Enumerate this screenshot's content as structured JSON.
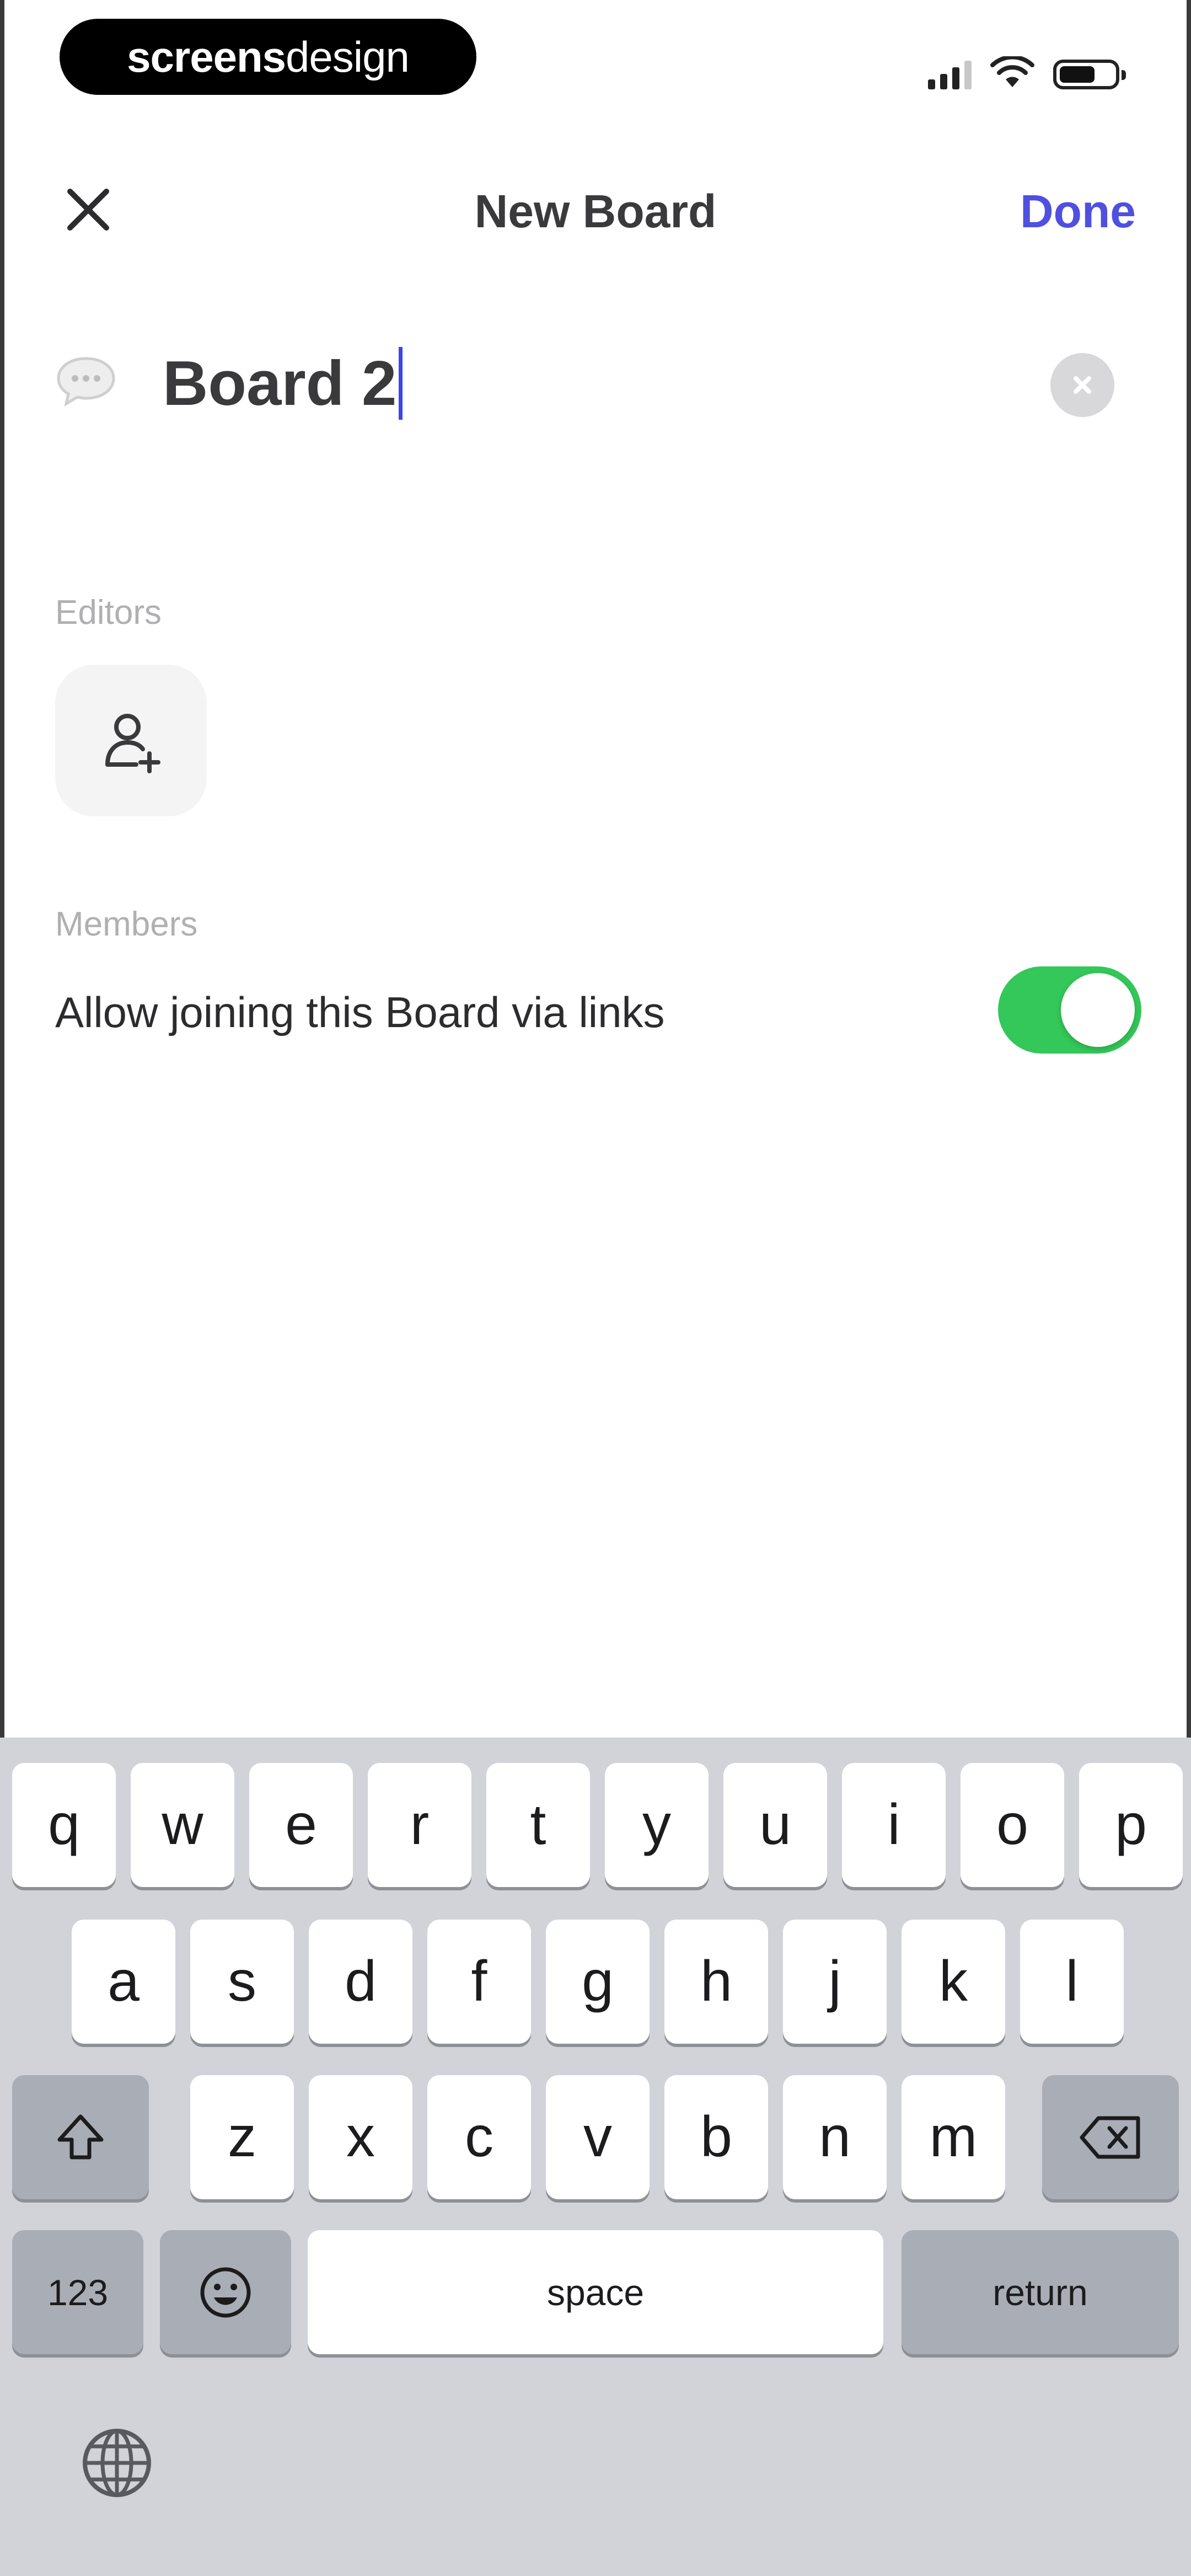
{
  "status_bar": {
    "brand_bold": "screens",
    "brand_light": "design"
  },
  "nav": {
    "title": "New Board",
    "done_label": "Done",
    "close_icon": "close-icon"
  },
  "board": {
    "name_value": "Board 2",
    "icon": "chat-bubble-icon",
    "clear_icon": "clear-circle-icon"
  },
  "editors": {
    "label": "Editors",
    "add_icon": "add-person-icon"
  },
  "members": {
    "label": "Members",
    "link_join_label": "Allow joining this Board via links",
    "link_join_enabled": true
  },
  "keyboard": {
    "row1": [
      "q",
      "w",
      "e",
      "r",
      "t",
      "y",
      "u",
      "i",
      "o",
      "p"
    ],
    "row2": [
      "a",
      "s",
      "d",
      "f",
      "g",
      "h",
      "j",
      "k",
      "l"
    ],
    "row3": [
      "z",
      "x",
      "c",
      "v",
      "b",
      "n",
      "m"
    ],
    "numbers_label": "123",
    "space_label": "space",
    "return_label": "return",
    "shift_icon": "shift-icon",
    "backspace_icon": "backspace-icon",
    "emoji_icon": "emoji-icon",
    "globe_icon": "globe-icon"
  },
  "colors": {
    "accent": "#4f4fe0",
    "toggle_on": "#34c759",
    "keyboard_bg": "#d1d3d9"
  }
}
